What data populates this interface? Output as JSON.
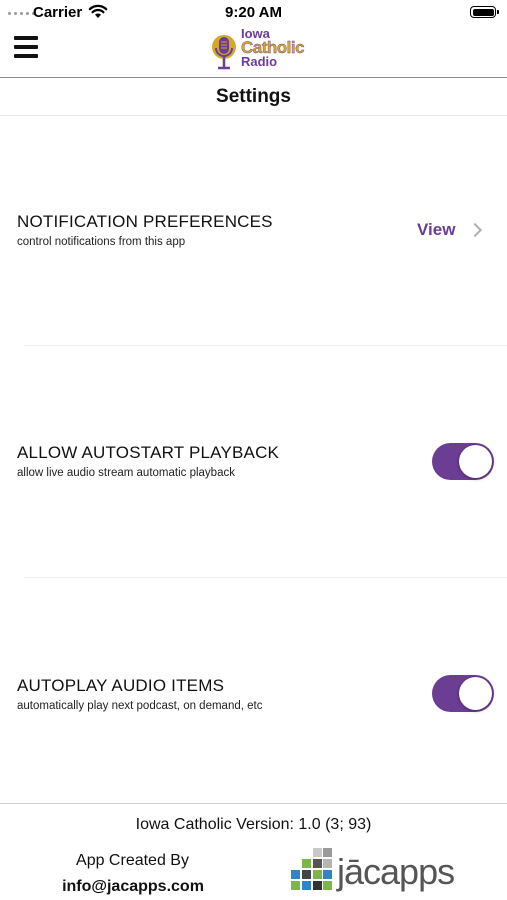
{
  "status_bar": {
    "carrier": "Carrier",
    "time": "9:20 AM"
  },
  "header": {
    "logo": {
      "line1": "Iowa",
      "line2": "Catholic",
      "line3": "Radio"
    },
    "title": "Settings"
  },
  "settings": [
    {
      "title": "NOTIFICATION PREFERENCES",
      "description": "control notifications from this app",
      "action_label": "View"
    },
    {
      "title": "ALLOW AUTOSTART PLAYBACK",
      "description": "allow live audio stream automatic playback",
      "toggle_on": true
    },
    {
      "title": "AUTOPLAY AUDIO ITEMS",
      "description": "automatically play next podcast, on demand, etc",
      "toggle_on": true
    }
  ],
  "footer": {
    "version": "Iowa Catholic Version: 1.0 (3; 93)",
    "created_by": "App Created By",
    "email": "info@jacapps.com",
    "brand": "jācapps"
  },
  "colors": {
    "accent": "#6b3d93",
    "logo_gold": "#d4a82a",
    "grid_green": "#7ab648",
    "grid_blue": "#2f86c6"
  },
  "icons": [
    "signal-dots-icon",
    "wifi-icon",
    "battery-icon",
    "hamburger-menu-icon",
    "microphone-icon",
    "chevron-right-icon",
    "jacapps-grid-icon"
  ]
}
